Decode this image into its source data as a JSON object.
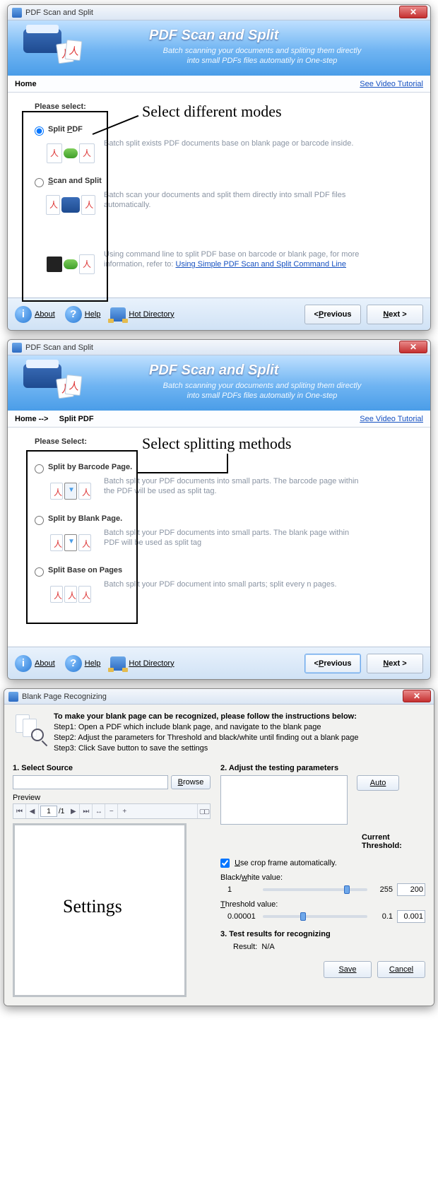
{
  "win1": {
    "title": "PDF Scan and Split",
    "banner_title": "PDF Scan and Split",
    "banner_sub1": "Batch scanning your documents and spliting them directly",
    "banner_sub2": "into small PDFs files automatily in One-step",
    "crumb": "Home",
    "video_link": "See Video Tutorial",
    "please": "Please select:",
    "annotation": "Select different modes",
    "opts": [
      {
        "label": "Split PDF",
        "desc": "Batch split exists PDF documents base on blank page or barcode inside.",
        "checked": true
      },
      {
        "label": "Scan and Split",
        "desc": "Batch scan your documents and split them directly into small PDF files automatically.",
        "checked": false
      }
    ],
    "cmd_desc_a": "Using command line to split PDF base on barcode or blank page, for more information, refer to: ",
    "cmd_link": "Using Simple PDF Scan and Split Command Line",
    "footer": {
      "about": "About",
      "help": "Help",
      "hot": "Hot Directory",
      "prev": "< Previous",
      "next": "Next >"
    }
  },
  "win2": {
    "title": "PDF Scan and Split",
    "banner_title": "PDF Scan and Split",
    "banner_sub1": "Batch scanning your documents and spliting them directly",
    "banner_sub2": "into small PDFs files automatily in One-step",
    "crumb": "Home -->     Split PDF",
    "video_link": "See Video Tutorial",
    "please": "Please Select:",
    "annotation": "Select splitting methods",
    "opts": [
      {
        "label": "Split by Barcode Page.",
        "desc": "Batch split your PDF documents into small parts. The barcode page within the PDF will be used as split tag."
      },
      {
        "label": "Split by Blank Page.",
        "desc": "Batch split your PDF documents into small parts. The blank page within PDF will be used as split tag"
      },
      {
        "label": "Split Base on Pages",
        "desc": "Batch split your PDF document into small parts; split every n pages."
      }
    ],
    "footer": {
      "about": "About",
      "help": "Help",
      "hot": "Hot Directory",
      "prev": "< Previous",
      "next": "Next >"
    }
  },
  "win3": {
    "title": "Blank Page Recognizing",
    "instr_hd": "To make your blank page can be recognized, please follow the instructions below:",
    "step1": "Step1: Open a PDF which include blank page, and navigate to the blank page",
    "step2": "Step2: Adjust the parameters for Threshold and black/white until finding out a blank page",
    "step3": "Step3: Click Save button to save the settings",
    "sec1": "1. Select Source",
    "browse": "Browse",
    "preview": "Preview",
    "page_cur": "1",
    "page_tot": "/1",
    "annotation": "Settings",
    "sec2": "2. Adjust the testing parameters",
    "auto": "Auto",
    "cur_thresh": "Current Threshold:",
    "use_crop": "Use crop frame automatically.",
    "bw_label": "Black/white value:",
    "bw_min": "1",
    "bw_max": "255",
    "bw_val": "200",
    "th_label": "Threshold value:",
    "th_min": "0.00001",
    "th_max": "0.1",
    "th_val": "0.001",
    "sec3": "3. Test results for recognizing",
    "result_lbl": "Result:",
    "result_val": "N/A",
    "save": "Save",
    "cancel": "Cancel"
  }
}
